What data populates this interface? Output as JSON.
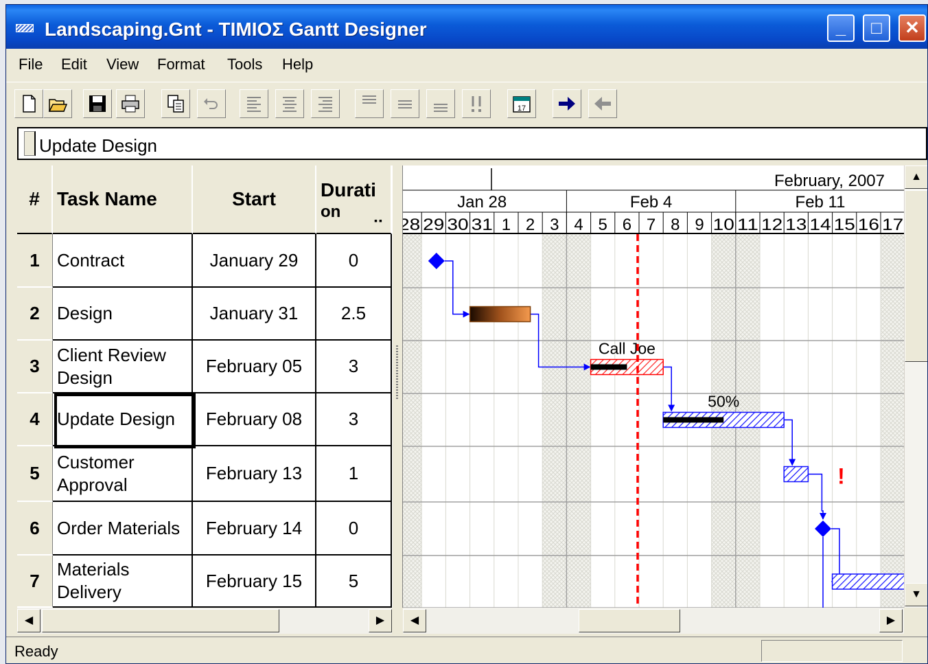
{
  "window": {
    "title": "Landscaping.Gnt - ΤΙΜΙΟΣ Gantt Designer",
    "controls": {
      "minimize": "_",
      "maximize": "□",
      "close": "✕"
    }
  },
  "menu": [
    "File",
    "Edit",
    "View",
    "Format",
    "Tools",
    "Help"
  ],
  "toolbar": {
    "buttons": [
      "new-icon",
      "open-icon",
      "save-icon",
      "print-icon",
      "copy-icon",
      "undo-icon",
      "align-left-icon",
      "align-center-icon",
      "align-right-icon",
      "align-top-icon",
      "align-middle-icon",
      "align-bottom-icon",
      "critical-icon",
      "calendar-icon",
      "indent-icon",
      "outdent-icon"
    ]
  },
  "name_box": {
    "value": "Update Design"
  },
  "grid": {
    "columns": {
      "num": "#",
      "name": "Task Name",
      "start": "Start",
      "duration_line1": "Durati",
      "duration_line2": "on",
      "duration_more": "▪▪"
    },
    "rows": [
      {
        "num": "1",
        "name": "Contract",
        "start": "January 29",
        "duration": "0"
      },
      {
        "num": "2",
        "name": "Design",
        "start": "January 31",
        "duration": "2.5"
      },
      {
        "num": "3",
        "name": "Client Review Design",
        "start": "February 05",
        "duration": "3"
      },
      {
        "num": "4",
        "name": "Update Design",
        "start": "February 08",
        "duration": "3",
        "selected": true
      },
      {
        "num": "5",
        "name": "Customer Approval",
        "start": "February 13",
        "duration": "1"
      },
      {
        "num": "6",
        "name": "Order Materials",
        "start": "February 14",
        "duration": "0"
      },
      {
        "num": "7",
        "name": "Materials Delivery",
        "start": "February 15",
        "duration": "5"
      }
    ]
  },
  "gantt": {
    "month": "February, 2007",
    "weeks": [
      "Jan 28",
      "Feb 4",
      "Feb 11"
    ],
    "days": [
      "28",
      "29",
      "30",
      "31",
      "1",
      "2",
      "3",
      "4",
      "5",
      "6",
      "7",
      "8",
      "9",
      "10",
      "11",
      "12",
      "13",
      "14",
      "15",
      "16",
      "17"
    ],
    "first_day_shown": "2007-01-28",
    "today_line": "2007-02-07",
    "tasks": [
      {
        "row": 1,
        "type": "milestone",
        "start": "2007-01-29"
      },
      {
        "row": 2,
        "type": "bar",
        "style": "gradient",
        "start": "2007-01-31",
        "duration": 2.5
      },
      {
        "row": 3,
        "type": "bar",
        "style": "red-hatch",
        "start": "2007-02-05",
        "duration": 3,
        "progress": 0.5,
        "label": "Call Joe"
      },
      {
        "row": 4,
        "type": "bar",
        "style": "blue-hatch",
        "start": "2007-02-08",
        "duration": 5,
        "progress": 0.5,
        "label": "50%"
      },
      {
        "row": 5,
        "type": "bar",
        "style": "blue-hatch",
        "start": "2007-02-13",
        "duration": 1,
        "flag": "!"
      },
      {
        "row": 6,
        "type": "milestone",
        "start": "2007-02-14"
      },
      {
        "row": 7,
        "type": "bar",
        "style": "blue-hatch",
        "start": "2007-02-15",
        "duration": 5
      }
    ],
    "colors": {
      "link": "#0000ff",
      "today": "#ff0000",
      "milestone": "#0000ff",
      "flag": "#ff0000"
    }
  },
  "status": {
    "text": "Ready"
  }
}
